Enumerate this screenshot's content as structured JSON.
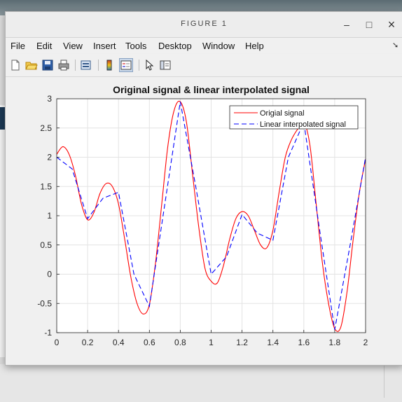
{
  "window": {
    "title": "FIGURE 1",
    "minimize": "–",
    "maximize": "□",
    "close": "×"
  },
  "menu": [
    "File",
    "Edit",
    "View",
    "Insert",
    "Tools",
    "Desktop",
    "Window",
    "Help"
  ],
  "menu_overflow_arrow": "➘",
  "toolbar_icons": [
    "new-figure-icon",
    "open-file-icon",
    "save-icon",
    "print-icon",
    "print-preview-icon",
    "colorbar-icon",
    "legend-icon",
    "pointer-icon",
    "property-editor-icon"
  ],
  "chart_data": {
    "type": "line",
    "title": "Original signal & linear interpolated signal",
    "xlim": [
      0,
      2
    ],
    "ylim": [
      -1,
      3
    ],
    "xticks": [
      "0",
      "0.2",
      "0.4",
      "0.6",
      "0.8",
      "1",
      "1.2",
      "1.4",
      "1.6",
      "1.8",
      "2"
    ],
    "yticks": [
      "3",
      "2.5",
      "2",
      "1.5",
      "1",
      "0.5",
      "0",
      "-0.5",
      "-1"
    ],
    "grid": true,
    "legend_position": "top-right",
    "series": [
      {
        "name": "Origial signal",
        "color": "#ff0000",
        "style": "solid",
        "x": [
          0,
          0.04,
          0.08,
          0.12,
          0.16,
          0.2,
          0.24,
          0.28,
          0.32,
          0.36,
          0.4,
          0.44,
          0.48,
          0.52,
          0.56,
          0.6,
          0.64,
          0.68,
          0.72,
          0.76,
          0.8,
          0.84,
          0.88,
          0.92,
          0.96,
          1.0,
          1.04,
          1.08,
          1.12,
          1.16,
          1.2,
          1.24,
          1.28,
          1.32,
          1.36,
          1.4,
          1.44,
          1.48,
          1.52,
          1.56,
          1.6,
          1.64,
          1.68,
          1.72,
          1.76,
          1.8,
          1.84,
          1.88,
          1.92,
          1.96,
          2.0
        ],
        "y": [
          2.05,
          2.18,
          2.05,
          1.7,
          1.2,
          0.93,
          1.05,
          1.38,
          1.55,
          1.5,
          1.2,
          0.6,
          -0.05,
          -0.5,
          -0.68,
          -0.52,
          0.2,
          1.2,
          2.2,
          2.8,
          2.95,
          2.6,
          1.7,
          0.8,
          0.1,
          -0.12,
          -0.15,
          0.15,
          0.6,
          0.95,
          1.07,
          1.0,
          0.75,
          0.5,
          0.45,
          0.75,
          1.4,
          2.0,
          2.3,
          2.48,
          2.6,
          2.2,
          1.2,
          0.2,
          -0.5,
          -0.93,
          -0.9,
          -0.3,
          0.6,
          1.4,
          1.97
        ]
      },
      {
        "name": "Linear interpolated signal",
        "color": "#0000ff",
        "style": "dashed",
        "x": [
          0,
          0.1,
          0.2,
          0.3,
          0.4,
          0.5,
          0.6,
          0.7,
          0.8,
          0.9,
          1.0,
          1.1,
          1.2,
          1.3,
          1.4,
          1.5,
          1.6,
          1.7,
          1.8,
          1.9,
          2.0
        ],
        "y": [
          2.0,
          1.8,
          0.95,
          1.3,
          1.4,
          0.0,
          -0.55,
          1.2,
          2.95,
          1.5,
          0.0,
          0.3,
          1.02,
          0.7,
          0.58,
          2.0,
          2.6,
          0.8,
          -0.95,
          0.5,
          2.0
        ]
      }
    ]
  }
}
